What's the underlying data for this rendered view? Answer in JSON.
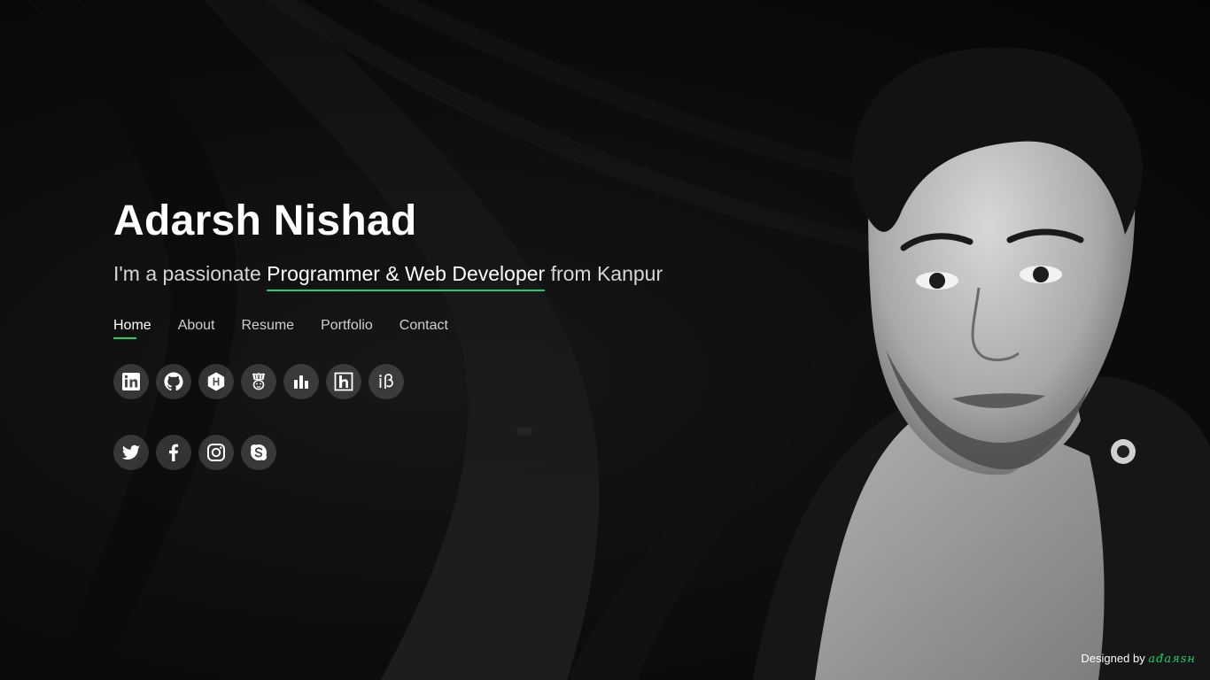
{
  "hero": {
    "name": "Adarsh Nishad",
    "tagline_prefix": "I'm a passionate ",
    "tagline_highlight": "Programmer & Web Developer",
    "tagline_suffix": " from Kanpur"
  },
  "nav": {
    "items": [
      "Home",
      "About",
      "Resume",
      "Portfolio",
      "Contact"
    ],
    "active": "Home"
  },
  "social": {
    "row1": [
      "linkedin-icon",
      "github-icon",
      "hackerrank-icon",
      "codechef-icon",
      "hackerearth-icon",
      "hashnode-icon",
      "interviewbit-icon"
    ],
    "row2": [
      "twitter-icon",
      "facebook-icon",
      "instagram-icon",
      "skype-icon"
    ]
  },
  "footer": {
    "designed_by": "Designed by",
    "brand": "ađaяsн"
  },
  "colors": {
    "accent": "#18d26e",
    "background": "#0b0b0b",
    "text": "#ffffff"
  }
}
